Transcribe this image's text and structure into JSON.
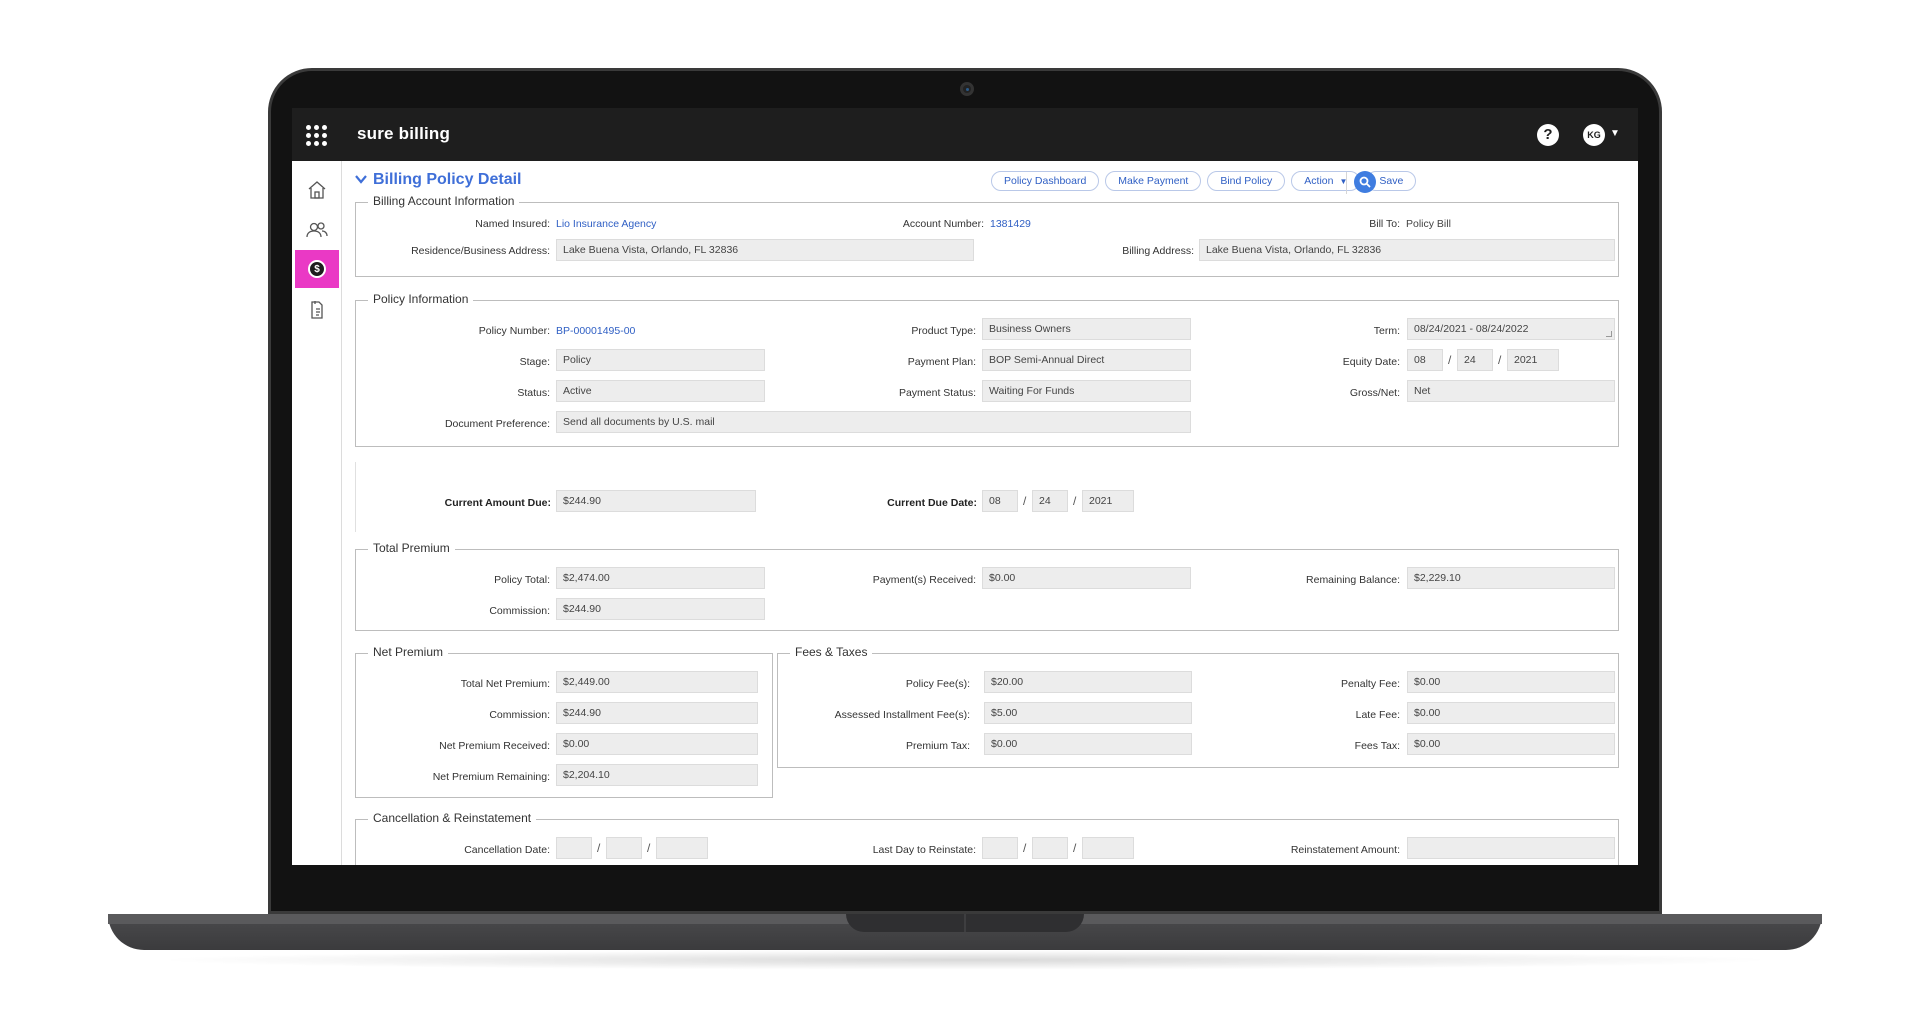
{
  "app": {
    "title": "sure billing",
    "avatar_initials": "KG"
  },
  "page": {
    "title": "Billing Policy Detail"
  },
  "actions": {
    "policy_dashboard": "Policy Dashboard",
    "make_payment": "Make Payment",
    "bind_policy": "Bind Policy",
    "action": "Action",
    "save": "Save"
  },
  "sidebar": {
    "items": [
      {
        "name": "home-icon"
      },
      {
        "name": "users-icon"
      },
      {
        "name": "billing-icon",
        "active": true
      },
      {
        "name": "documents-icon"
      }
    ]
  },
  "billing_account": {
    "legend": "Billing Account Information",
    "named_insured_label": "Named Insured:",
    "named_insured": "Lio Insurance Agency",
    "account_number_label": "Account Number:",
    "account_number": "1381429",
    "bill_to_label": "Bill To:",
    "bill_to": "Policy Bill",
    "residence_label": "Residence/Business Address:",
    "residence": "Lake Buena Vista, Orlando, FL 32836",
    "billing_address_label": "Billing Address:",
    "billing_address": "Lake Buena Vista, Orlando, FL 32836"
  },
  "policy_info": {
    "legend": "Policy Information",
    "policy_number_label": "Policy Number:",
    "policy_number": "BP-00001495-00",
    "product_type_label": "Product Type:",
    "product_type": "Business Owners",
    "term_label": "Term:",
    "term": "08/24/2021 - 08/24/2022",
    "stage_label": "Stage:",
    "stage": "Policy",
    "payment_plan_label": "Payment Plan:",
    "payment_plan": "BOP Semi-Annual Direct",
    "equity_date_label": "Equity Date:",
    "equity_mm": "08",
    "equity_dd": "24",
    "equity_yyyy": "2021",
    "status_label": "Status:",
    "status": "Active",
    "payment_status_label": "Payment Status:",
    "payment_status": "Waiting For Funds",
    "gross_net_label": "Gross/Net:",
    "gross_net": "Net",
    "doc_pref_label": "Document Preference:",
    "doc_pref": "Send all documents by U.S. mail"
  },
  "due": {
    "current_amount_label": "Current Amount Due:",
    "current_amount": "$244.90",
    "current_due_date_label": "Current Due Date:",
    "due_mm": "08",
    "due_dd": "24",
    "due_yyyy": "2021"
  },
  "total_premium": {
    "legend": "Total Premium",
    "policy_total_label": "Policy Total:",
    "policy_total": "$2,474.00",
    "payments_received_label": "Payment(s) Received:",
    "payments_received": "$0.00",
    "remaining_balance_label": "Remaining Balance:",
    "remaining_balance": "$2,229.10",
    "commission_label": "Commission:",
    "commission": "$244.90"
  },
  "net_premium": {
    "legend": "Net Premium",
    "total_net_label": "Total Net Premium:",
    "total_net": "$2,449.00",
    "commission_label": "Commission:",
    "commission": "$244.90",
    "received_label": "Net Premium Received:",
    "received": "$0.00",
    "remaining_label": "Net Premium Remaining:",
    "remaining": "$2,204.10"
  },
  "fees": {
    "legend": "Fees & Taxes",
    "policy_fees_label": "Policy Fee(s):",
    "policy_fees": "$20.00",
    "penalty_fee_label": "Penalty Fee:",
    "penalty_fee": "$0.00",
    "installment_label": "Assessed Installment Fee(s):",
    "installment": "$5.00",
    "late_fee_label": "Late Fee:",
    "late_fee": "$0.00",
    "premium_tax_label": "Premium Tax:",
    "premium_tax": "$0.00",
    "fees_tax_label": "Fees Tax:",
    "fees_tax": "$0.00"
  },
  "cancellation": {
    "legend": "Cancellation & Reinstatement",
    "cancellation_date_label": "Cancellation Date:",
    "last_day_label": "Last Day to Reinstate:",
    "reinstatement_amount_label": "Reinstatement Amount:"
  },
  "colors": {
    "accent": "#3f6fd8",
    "active_nav": "#ea39c5",
    "topbar": "#1e1e1e"
  }
}
